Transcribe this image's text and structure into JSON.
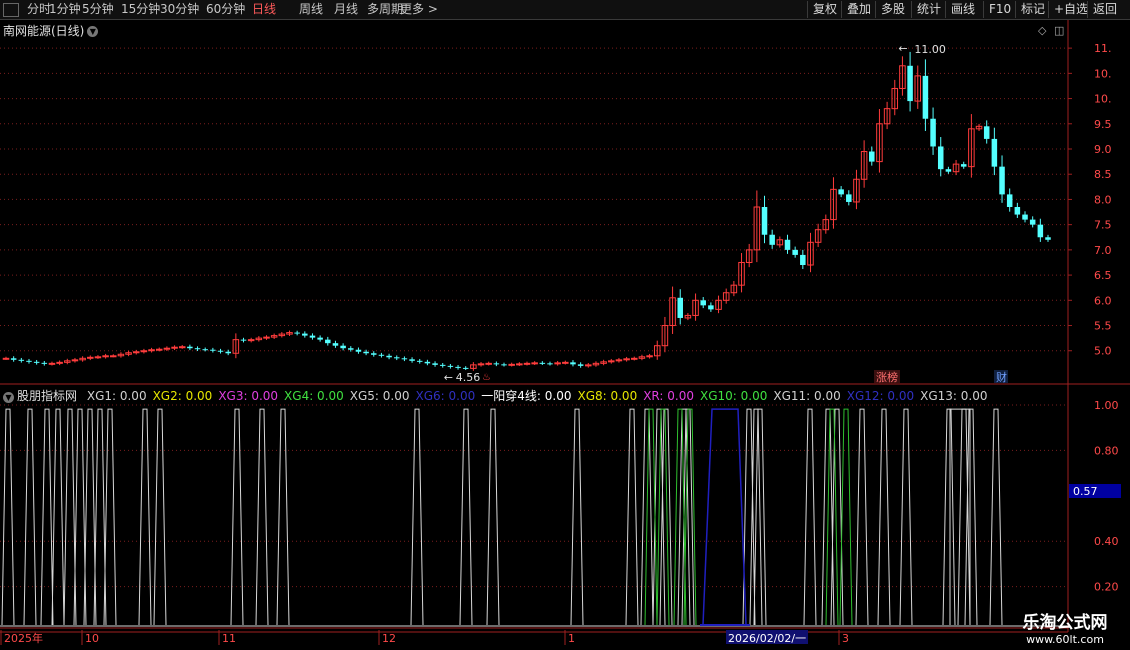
{
  "toolbar": {
    "left_items": [
      "分时",
      "1分钟",
      "5分钟",
      "15分钟",
      "30分钟",
      "60分钟",
      "日线",
      "周线",
      "月线",
      "多周期",
      "更多 >"
    ],
    "active_item": "日线",
    "right_items": [
      "复权",
      "叠加",
      "多股",
      "统计",
      "画线",
      "F10",
      "标记",
      "+自选",
      "返回"
    ]
  },
  "chart_title": "南网能源(日线)",
  "indicator": {
    "name": "股朋指标网",
    "items": [
      {
        "text": "XG1: 0.00",
        "color": "#d0d0d0"
      },
      {
        "text": "XG2: 0.00",
        "color": "#e6e600"
      },
      {
        "text": "XG3: 0.00",
        "color": "#e040e0"
      },
      {
        "text": "XG4: 0.00",
        "color": "#40e040"
      },
      {
        "text": "XG5: 0.00",
        "color": "#d0d0d0"
      },
      {
        "text": "XG6: 0.00",
        "color": "#3030c0"
      },
      {
        "text": "一阳穿4线: 0.00",
        "color": "#ffffff"
      },
      {
        "text": "XG8: 0.00",
        "color": "#e6e600"
      },
      {
        "text": "XR: 0.00",
        "color": "#e040e0"
      },
      {
        "text": "XG10: 0.00",
        "color": "#40e040"
      },
      {
        "text": "XG11: 0.00",
        "color": "#d0d0d0"
      },
      {
        "text": "XG12: 0.00",
        "color": "#3030c0"
      },
      {
        "text": "XG13: 0.00",
        "color": "#d0d0d0"
      }
    ]
  },
  "price_axis": [
    "11.00",
    "10.50",
    "10.00",
    "9.50",
    "9.00",
    "8.50",
    "8.00",
    "7.50",
    "7.00",
    "6.50",
    "6.00",
    "5.50",
    "5.00"
  ],
  "indicator_axis": [
    "1.00",
    "0.80",
    "0.40",
    "0.20"
  ],
  "indicator_current": "0.57",
  "annotations": {
    "high": "11.00",
    "low": "4.56",
    "tag1": "涨榜",
    "tag2": "财"
  },
  "date_labels": [
    "2025年",
    "10",
    "11",
    "12",
    "1",
    "2026/02/02/一",
    "3"
  ],
  "watermark": {
    "line1": "乐淘公式网",
    "line2": "www.60lt.com"
  },
  "colors": {
    "up": "#ff3c3c",
    "down": "#54ffff",
    "grid": "#7a1e1e",
    "axis": "#a02020"
  },
  "chart_data": {
    "type": "candlestick",
    "title": "南网能源(日线)",
    "ylim": [
      4.4,
      11.3
    ],
    "marked_high": 11.0,
    "marked_low": 4.56,
    "close": [
      4.85,
      4.82,
      4.8,
      4.78,
      4.76,
      4.74,
      4.75,
      4.77,
      4.8,
      4.82,
      4.85,
      4.87,
      4.88,
      4.9,
      4.9,
      4.93,
      4.96,
      4.98,
      5.0,
      5.02,
      5.03,
      5.05,
      5.07,
      5.08,
      5.05,
      5.03,
      5.02,
      5.0,
      4.98,
      4.95,
      5.22,
      5.2,
      5.22,
      5.25,
      5.27,
      5.3,
      5.33,
      5.36,
      5.34,
      5.3,
      5.26,
      5.22,
      5.15,
      5.1,
      5.05,
      5.02,
      4.98,
      4.95,
      4.92,
      4.9,
      4.87,
      4.85,
      4.83,
      4.8,
      4.78,
      4.75,
      4.72,
      4.7,
      4.68,
      4.66,
      4.65,
      4.72,
      4.74,
      4.75,
      4.73,
      4.72,
      4.73,
      4.74,
      4.75,
      4.76,
      4.75,
      4.74,
      4.76,
      4.77,
      4.73,
      4.7,
      4.72,
      4.75,
      4.78,
      4.8,
      4.82,
      4.84,
      4.85,
      4.88,
      4.9,
      5.1,
      5.5,
      6.05,
      5.65,
      5.7,
      6.0,
      5.9,
      5.82,
      6.0,
      6.15,
      6.3,
      6.75,
      7.0,
      7.85,
      7.3,
      7.1,
      7.2,
      7.0,
      6.9,
      6.7,
      7.15,
      7.4,
      7.6,
      8.2,
      8.1,
      7.95,
      8.4,
      8.95,
      8.75,
      9.5,
      9.8,
      10.2,
      10.65,
      9.95,
      10.45,
      9.6,
      9.05,
      8.6,
      8.55,
      8.7,
      8.65,
      9.4,
      9.45,
      9.2,
      8.65,
      8.1,
      7.85,
      7.7,
      7.6,
      7.5,
      7.25,
      7.2
    ],
    "indicator_series": [
      {
        "name": "XG1",
        "color": "#d8d8d8",
        "level": 0.96
      },
      {
        "name": "XG4",
        "color": "#30c030",
        "level": 0.96
      },
      {
        "name": "XG6",
        "color": "#2020c0",
        "level": 0.96
      }
    ],
    "indicator_ylim": [
      0,
      1.0
    ]
  }
}
